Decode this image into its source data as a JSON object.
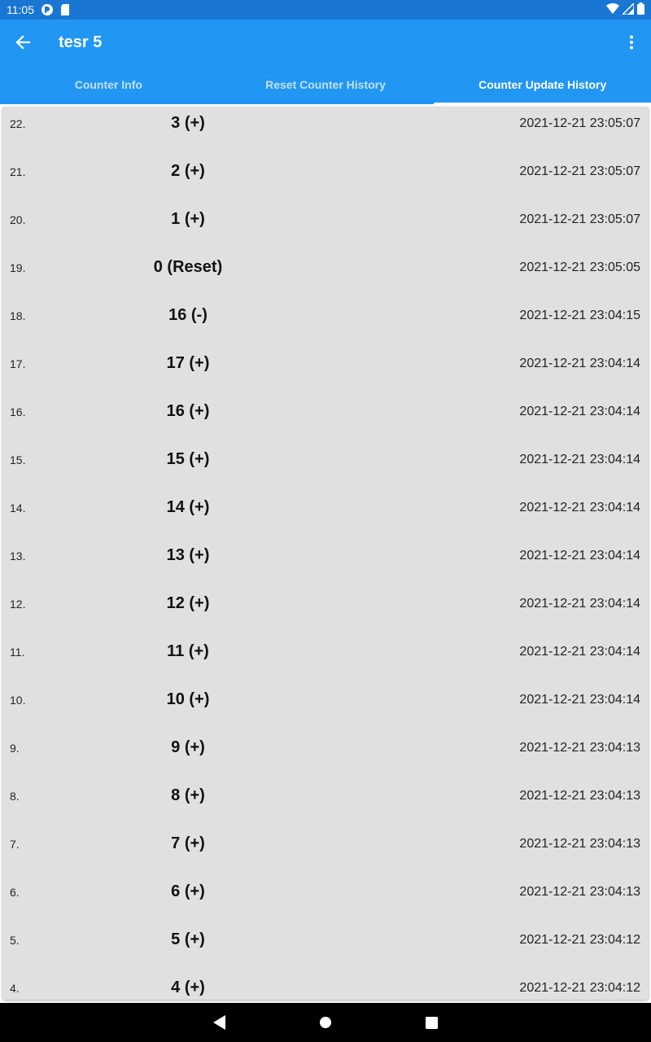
{
  "status_bar": {
    "time": "11:05",
    "icons": [
      "cast-icon",
      "sd-card-icon",
      "wifi-icon",
      "signal-icon",
      "battery-icon"
    ]
  },
  "app_bar": {
    "title": "tesr 5",
    "color": "#2196F3",
    "tabs": [
      {
        "label": "Counter Info",
        "active": false
      },
      {
        "label": "Reset Counter History",
        "active": false
      },
      {
        "label": "Counter Update History",
        "active": true
      }
    ]
  },
  "history": [
    {
      "index": "22.",
      "value": "3 (+)",
      "timestamp": "2021-12-21 23:05:07"
    },
    {
      "index": "21.",
      "value": "2 (+)",
      "timestamp": "2021-12-21 23:05:07"
    },
    {
      "index": "20.",
      "value": "1 (+)",
      "timestamp": "2021-12-21 23:05:07"
    },
    {
      "index": "19.",
      "value": "0 (Reset)",
      "timestamp": "2021-12-21 23:05:05"
    },
    {
      "index": "18.",
      "value": "16 (-)",
      "timestamp": "2021-12-21 23:04:15"
    },
    {
      "index": "17.",
      "value": "17 (+)",
      "timestamp": "2021-12-21 23:04:14"
    },
    {
      "index": "16.",
      "value": "16 (+)",
      "timestamp": "2021-12-21 23:04:14"
    },
    {
      "index": "15.",
      "value": "15 (+)",
      "timestamp": "2021-12-21 23:04:14"
    },
    {
      "index": "14.",
      "value": "14 (+)",
      "timestamp": "2021-12-21 23:04:14"
    },
    {
      "index": "13.",
      "value": "13 (+)",
      "timestamp": "2021-12-21 23:04:14"
    },
    {
      "index": "12.",
      "value": "12 (+)",
      "timestamp": "2021-12-21 23:04:14"
    },
    {
      "index": "11.",
      "value": "11 (+)",
      "timestamp": "2021-12-21 23:04:14"
    },
    {
      "index": "10.",
      "value": "10 (+)",
      "timestamp": "2021-12-21 23:04:14"
    },
    {
      "index": "9.",
      "value": "9 (+)",
      "timestamp": "2021-12-21 23:04:13"
    },
    {
      "index": "8.",
      "value": "8 (+)",
      "timestamp": "2021-12-21 23:04:13"
    },
    {
      "index": "7.",
      "value": "7 (+)",
      "timestamp": "2021-12-21 23:04:13"
    },
    {
      "index": "6.",
      "value": "6 (+)",
      "timestamp": "2021-12-21 23:04:13"
    },
    {
      "index": "5.",
      "value": "5 (+)",
      "timestamp": "2021-12-21 23:04:12"
    },
    {
      "index": "4.",
      "value": "4 (+)",
      "timestamp": "2021-12-21 23:04:12"
    }
  ],
  "nav_bar": {
    "buttons": [
      "back-icon",
      "home-icon",
      "recents-icon"
    ]
  }
}
